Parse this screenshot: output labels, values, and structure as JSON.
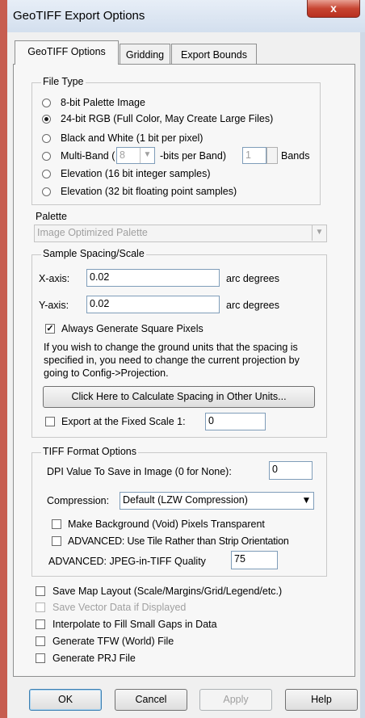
{
  "window": {
    "title": "GeoTIFF Export Options",
    "close_label": "x"
  },
  "tabs": [
    {
      "label": "GeoTIFF Options"
    },
    {
      "label": "Gridding"
    },
    {
      "label": "Export Bounds"
    }
  ],
  "file_type": {
    "legend": "File Type",
    "options": [
      {
        "label": "8-bit Palette Image",
        "selected": false
      },
      {
        "label": "24-bit RGB (Full Color, May Create Large Files)",
        "selected": true
      },
      {
        "label": "Black and White (1 bit per pixel)",
        "selected": false
      },
      {
        "label": "Multi-Band (",
        "selected": false
      },
      {
        "label": "Elevation (16 bit integer samples)",
        "selected": false
      },
      {
        "label": "Elevation (32 bit floating point samples)",
        "selected": false
      }
    ],
    "multiband": {
      "bits_value": "8",
      "bits_label": "-bits per Band)",
      "bands_value": "1",
      "bands_label": "Bands"
    }
  },
  "palette": {
    "label": "Palette",
    "value": "Image Optimized Palette"
  },
  "sample_spacing": {
    "legend": "Sample Spacing/Scale",
    "x_label": "X-axis:",
    "x_value": "0.02",
    "x_unit": "arc degrees",
    "y_label": "Y-axis:",
    "y_value": "0.02",
    "y_unit": "arc degrees",
    "square_pixels_label": "Always Generate Square Pixels",
    "info_text": "If you wish to change the ground units that the spacing is specified in, you need to change the current projection by going to Config->Projection.",
    "calc_button": "Click Here to Calculate Spacing in Other Units...",
    "fixed_scale_label": "Export at the Fixed Scale 1:",
    "fixed_scale_value": "0"
  },
  "tiff_format": {
    "legend": "TIFF Format Options",
    "dpi_label": "DPI Value To Save in Image (0 for None):",
    "dpi_value": "0",
    "compression_label": "Compression:",
    "compression_value": "Default (LZW Compression)",
    "transparent_label": "Make Background (Void) Pixels Transparent",
    "tile_label": "ADVANCED: Use Tile Rather than Strip Orientation",
    "jpeg_label": "ADVANCED: JPEG-in-TIFF Quality",
    "jpeg_value": "75"
  },
  "options": [
    {
      "label": "Save Map Layout (Scale/Margins/Grid/Legend/etc.)",
      "enabled": true
    },
    {
      "label": "Save Vector Data if Displayed",
      "enabled": false
    },
    {
      "label": "Interpolate to Fill Small Gaps in Data",
      "enabled": true
    },
    {
      "label": "Generate TFW (World) File",
      "enabled": true
    },
    {
      "label": "Generate PRJ File",
      "enabled": true
    }
  ],
  "buttons": {
    "ok": "OK",
    "cancel": "Cancel",
    "apply": "Apply",
    "help": "Help"
  }
}
